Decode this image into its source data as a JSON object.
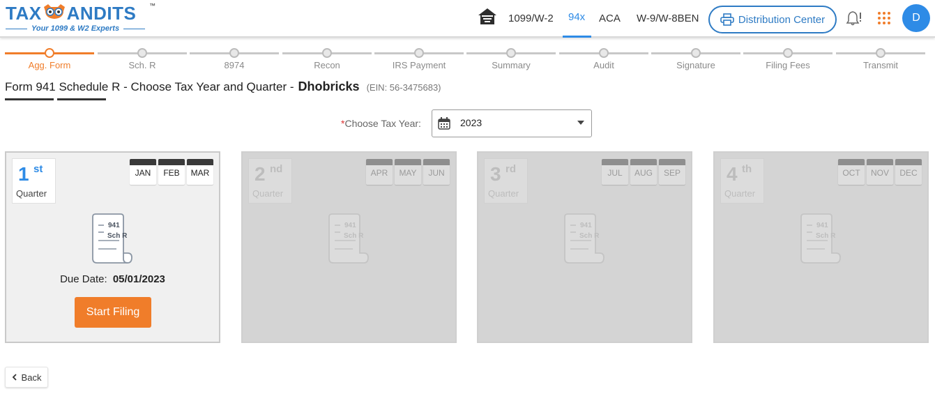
{
  "logo": {
    "brand_left": "TAX",
    "brand_right": "ANDITS",
    "trademark": "™",
    "tagline": "Your 1099 & W2 Experts"
  },
  "nav": {
    "items": [
      {
        "label": "1099/W-2",
        "active": false
      },
      {
        "label": "94x",
        "active": true
      },
      {
        "label": "ACA",
        "active": false
      },
      {
        "label": "W-9/W-8BEN",
        "active": false
      }
    ],
    "distribution_center": "Distribution Center",
    "avatar_initial": "D"
  },
  "stepper": {
    "steps": [
      {
        "label": "Agg. Form",
        "active": true
      },
      {
        "label": "Sch. R",
        "active": false
      },
      {
        "label": "8974",
        "active": false
      },
      {
        "label": "Recon",
        "active": false
      },
      {
        "label": "IRS Payment",
        "active": false
      },
      {
        "label": "Summary",
        "active": false
      },
      {
        "label": "Audit",
        "active": false
      },
      {
        "label": "Signature",
        "active": false
      },
      {
        "label": "Filing Fees",
        "active": false
      },
      {
        "label": "Transmit",
        "active": false
      }
    ]
  },
  "page": {
    "title": "Form 941 Schedule R - Choose Tax Year and Quarter -",
    "company": "Dhobricks",
    "ein": "(EIN: 56-3475683)"
  },
  "tax_year": {
    "required_mark": "*",
    "label": "Choose Tax Year:",
    "value": "2023"
  },
  "quarters": [
    {
      "num": "1",
      "suffix": "st",
      "label": "Quarter",
      "months": [
        "JAN",
        "FEB",
        "MAR"
      ],
      "doc_line1": "941",
      "doc_line2": "Sch R",
      "due_label": "Due Date:",
      "due_date": "05/01/2023",
      "button": "Start Filing",
      "active": true
    },
    {
      "num": "2",
      "suffix": "nd",
      "label": "Quarter",
      "months": [
        "APR",
        "MAY",
        "JUN"
      ],
      "doc_line1": "941",
      "doc_line2": "Sch R",
      "active": false
    },
    {
      "num": "3",
      "suffix": "rd",
      "label": "Quarter",
      "months": [
        "JUL",
        "AUG",
        "SEP"
      ],
      "doc_line1": "941",
      "doc_line2": "Sch R",
      "active": false
    },
    {
      "num": "4",
      "suffix": "th",
      "label": "Quarter",
      "months": [
        "OCT",
        "NOV",
        "DEC"
      ],
      "doc_line1": "941",
      "doc_line2": "Sch R",
      "active": false
    }
  ],
  "back_label": "Back",
  "colors": {
    "accent_orange": "#f07d2a",
    "brand_blue": "#2e7bc4",
    "link_blue": "#2e8be6"
  }
}
